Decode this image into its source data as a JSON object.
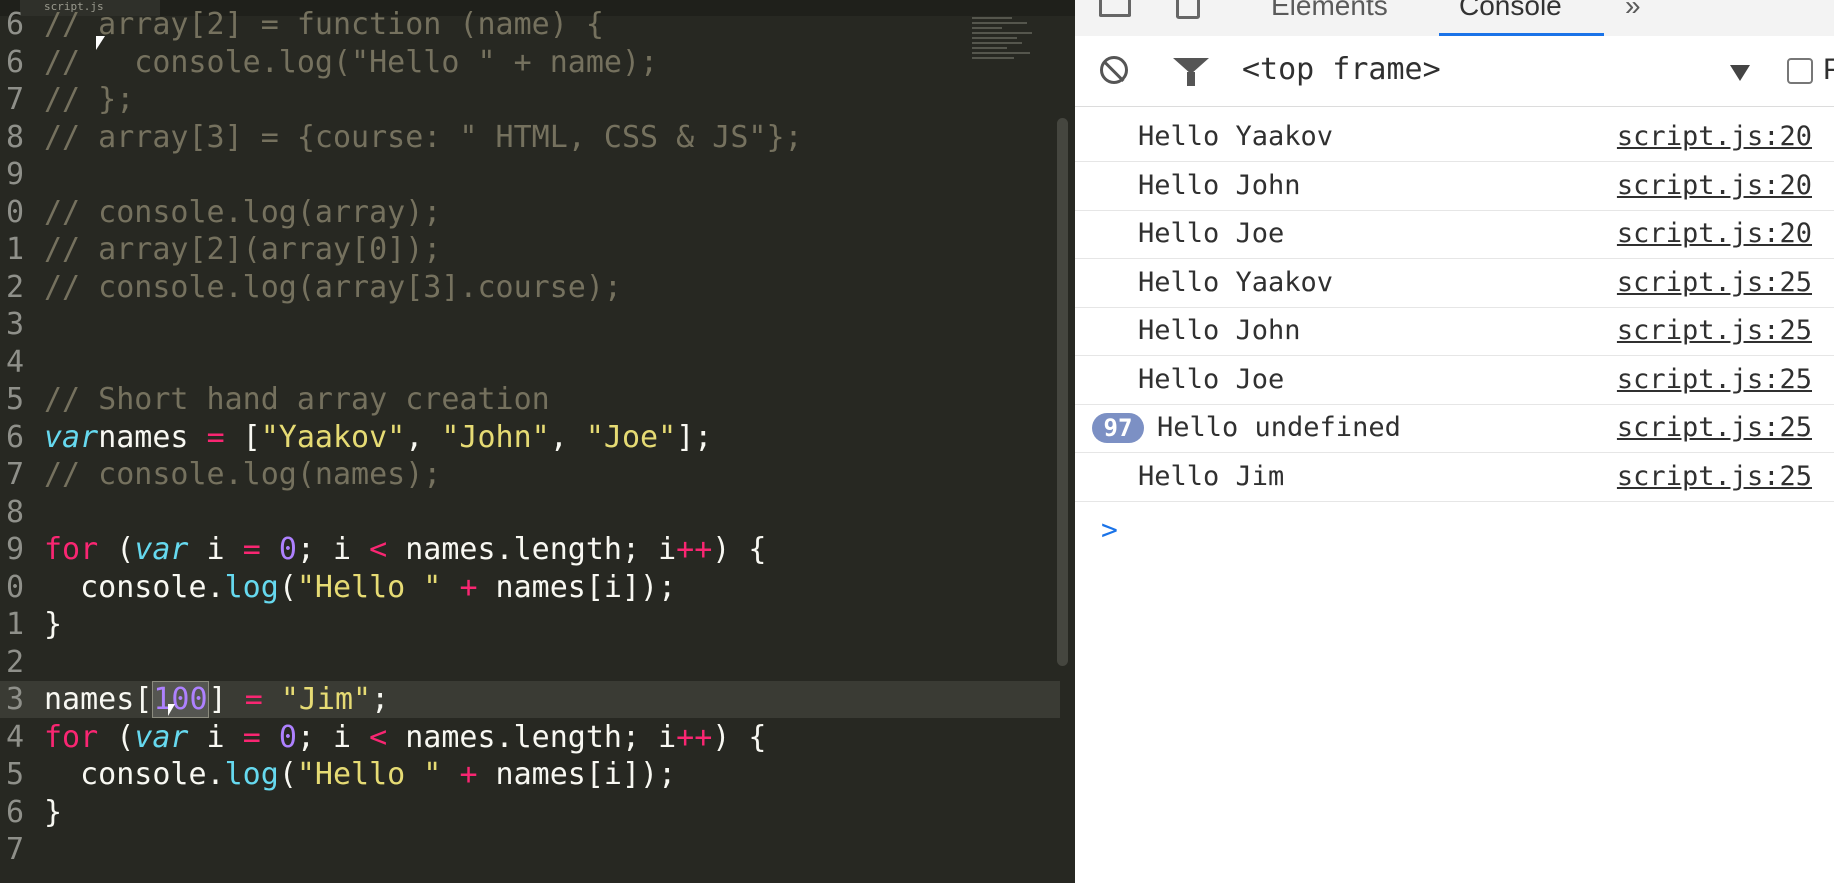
{
  "editor": {
    "tab_label": "script.js",
    "lines": [
      {
        "n": "6",
        "spans": [
          [
            "cm",
            "// array[2] = function (name) {"
          ]
        ]
      },
      {
        "n": "6",
        "spans": [
          [
            "cm",
            "//   console.log(\"Hello \" + name);"
          ]
        ]
      },
      {
        "n": "7",
        "spans": [
          [
            "cm",
            "// };"
          ]
        ]
      },
      {
        "n": "8",
        "spans": [
          [
            "cm",
            "// array[3] = {course: \" HTML, CSS & JS\"};"
          ]
        ]
      },
      {
        "n": "9",
        "spans": []
      },
      {
        "n": "0",
        "spans": [
          [
            "cm",
            "// console.log(array);"
          ]
        ]
      },
      {
        "n": "1",
        "spans": [
          [
            "cm",
            "// array[2](array[0]);"
          ]
        ]
      },
      {
        "n": "2",
        "spans": [
          [
            "cm",
            "// console.log(array[3].course);"
          ]
        ]
      },
      {
        "n": "3",
        "spans": []
      },
      {
        "n": "4",
        "spans": []
      },
      {
        "n": "5",
        "spans": [
          [
            "cm",
            "// Short hand array creation"
          ]
        ]
      },
      {
        "n": "6",
        "spans": [
          [
            "sto",
            "var"
          ],
          [
            "",
            "names "
          ],
          [
            "op",
            "="
          ],
          [
            "",
            " ["
          ],
          [
            "str",
            "\"Yaakov\""
          ],
          [
            "",
            ", "
          ],
          [
            "str",
            "\"John\""
          ],
          [
            "",
            ", "
          ],
          [
            "str",
            "\"Joe\""
          ],
          [
            "",
            "];"
          ]
        ]
      },
      {
        "n": "7",
        "spans": [
          [
            "cm",
            "// console.log(names);"
          ]
        ]
      },
      {
        "n": "8",
        "spans": []
      },
      {
        "n": "9",
        "spans": [
          [
            "kw",
            "for"
          ],
          [
            "",
            " ("
          ],
          [
            "sto",
            "var"
          ],
          [
            "",
            " i "
          ],
          [
            "op",
            "="
          ],
          [
            "",
            " "
          ],
          [
            "num",
            "0"
          ],
          [
            "",
            "; i "
          ],
          [
            "op",
            "<"
          ],
          [
            "",
            " names.length; i"
          ],
          [
            "op",
            "++"
          ],
          [
            "",
            ") {"
          ]
        ]
      },
      {
        "n": "0",
        "spans": [
          [
            "",
            "  console."
          ],
          [
            "fn",
            "log"
          ],
          [
            "",
            "("
          ],
          [
            "str",
            "\"Hello \""
          ],
          [
            "",
            " "
          ],
          [
            "op",
            "+"
          ],
          [
            "",
            " names[i]);"
          ]
        ]
      },
      {
        "n": "1",
        "spans": [
          [
            "",
            "}"
          ]
        ]
      },
      {
        "n": "2",
        "spans": []
      },
      {
        "n": "3",
        "active": true,
        "spans": [
          [
            "",
            "names["
          ],
          [
            "num sel",
            "100"
          ],
          [
            "",
            "] "
          ],
          [
            "op",
            "="
          ],
          [
            "",
            " "
          ],
          [
            "str",
            "\"Jim\""
          ],
          [
            "",
            ";"
          ]
        ]
      },
      {
        "n": "4",
        "spans": [
          [
            "kw",
            "for"
          ],
          [
            "",
            " ("
          ],
          [
            "sto",
            "var"
          ],
          [
            "",
            " i "
          ],
          [
            "op",
            "="
          ],
          [
            "",
            " "
          ],
          [
            "num",
            "0"
          ],
          [
            "",
            "; i "
          ],
          [
            "op",
            "<"
          ],
          [
            "",
            " names.length; i"
          ],
          [
            "op",
            "++"
          ],
          [
            "",
            ") {"
          ]
        ]
      },
      {
        "n": "5",
        "spans": [
          [
            "",
            "  console."
          ],
          [
            "fn",
            "log"
          ],
          [
            "",
            "("
          ],
          [
            "str",
            "\"Hello \""
          ],
          [
            "",
            " "
          ],
          [
            "op",
            "+"
          ],
          [
            "",
            " names[i]);"
          ]
        ]
      },
      {
        "n": "6",
        "spans": [
          [
            "",
            "}"
          ]
        ]
      },
      {
        "n": "7",
        "spans": []
      }
    ]
  },
  "devtools": {
    "tabs": {
      "elements": "Elements",
      "console": "Console",
      "more": "»"
    },
    "toolbar": {
      "frame_label": "<top frame>",
      "preserve_label": "P"
    },
    "colors": {
      "accent": "#1a73e8",
      "badge": "#7c90c4"
    },
    "logs": [
      {
        "message": "Hello Yaakov",
        "source": "script.js:20"
      },
      {
        "message": "Hello John",
        "source": "script.js:20"
      },
      {
        "message": "Hello Joe",
        "source": "script.js:20"
      },
      {
        "message": "Hello Yaakov",
        "source": "script.js:25"
      },
      {
        "message": "Hello John",
        "source": "script.js:25"
      },
      {
        "message": "Hello Joe",
        "source": "script.js:25"
      },
      {
        "message": "Hello undefined",
        "source": "script.js:25",
        "count": "97"
      },
      {
        "message": "Hello Jim",
        "source": "script.js:25"
      }
    ],
    "prompt_symbol": ">"
  }
}
